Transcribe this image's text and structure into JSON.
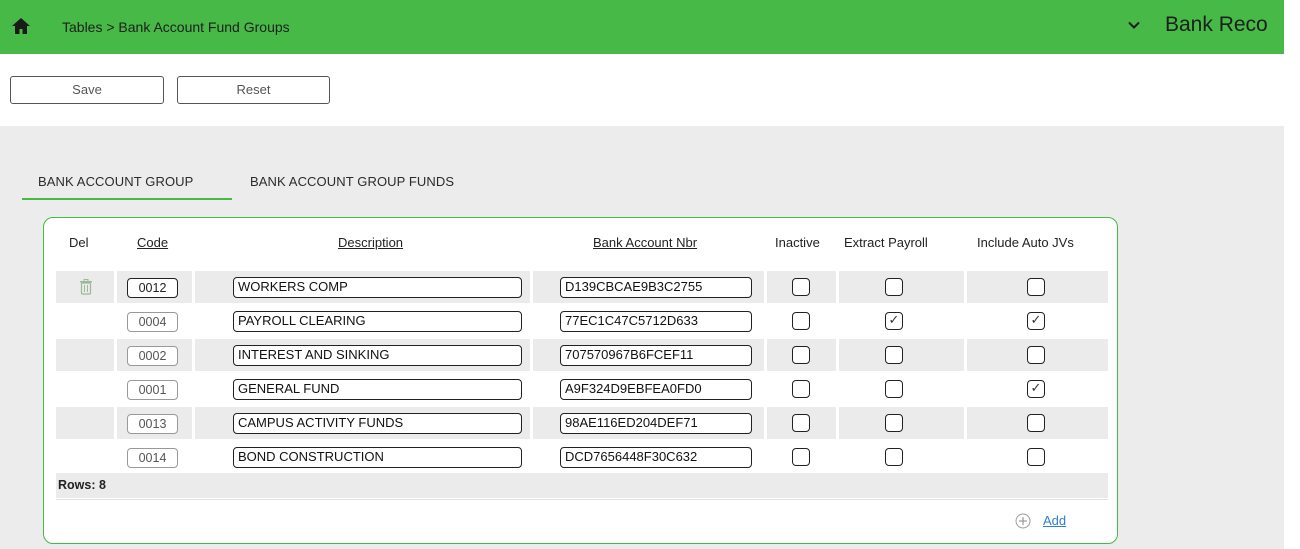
{
  "header": {
    "home_icon": "home-icon",
    "breadcrumb": "Tables > Bank Account Fund Groups",
    "chevron_icon": "chevron-down-icon",
    "module_title": "Bank Reco",
    "bar_color": "#46b946"
  },
  "toolbar": {
    "save_label": "Save",
    "reset_label": "Reset"
  },
  "tabs": [
    {
      "label": "BANK ACCOUNT GROUP",
      "active": true
    },
    {
      "label": "BANK ACCOUNT GROUP FUNDS",
      "active": false
    }
  ],
  "table": {
    "headers": {
      "del": "Del",
      "code": "Code",
      "description": "Description",
      "bank_account_nbr": "Bank Account Nbr",
      "inactive": "Inactive",
      "extract_payroll": "Extract Payroll",
      "include_auto_jvs": "Include Auto JVs"
    },
    "rows": [
      {
        "code": "0012",
        "description": "WORKERS COMP",
        "bank_account_nbr": "D139CBCAE9B3C2755",
        "inactive": false,
        "extract_payroll": false,
        "include_auto_jvs": false
      },
      {
        "code": "0004",
        "description": "PAYROLL CLEARING",
        "bank_account_nbr": "77EC1C47C5712D633",
        "inactive": false,
        "extract_payroll": true,
        "include_auto_jvs": true
      },
      {
        "code": "0002",
        "description": "INTEREST AND SINKING",
        "bank_account_nbr": "707570967B6FCEF11",
        "inactive": false,
        "extract_payroll": false,
        "include_auto_jvs": false
      },
      {
        "code": "0001",
        "description": "GENERAL FUND",
        "bank_account_nbr": "A9F324D9EBFEA0FD0",
        "inactive": false,
        "extract_payroll": false,
        "include_auto_jvs": true
      },
      {
        "code": "0013",
        "description": "CAMPUS ACTIVITY FUNDS",
        "bank_account_nbr": "98AE116ED204DEF71",
        "inactive": false,
        "extract_payroll": false,
        "include_auto_jvs": false
      },
      {
        "code": "0014",
        "description": "BOND CONSTRUCTION",
        "bank_account_nbr": "DCD7656448F30C632",
        "inactive": false,
        "extract_payroll": false,
        "include_auto_jvs": false
      }
    ],
    "rows_count": "Rows: 8",
    "add_label": "Add",
    "add_icon": "plus-circle-icon",
    "delete_icon": "trash-icon"
  }
}
